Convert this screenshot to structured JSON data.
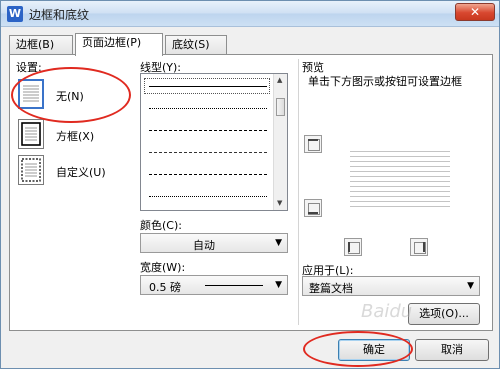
{
  "window": {
    "title": "边框和底纹",
    "app_icon": "W",
    "close_label": "✕"
  },
  "tabs": [
    {
      "label": "边框(B)"
    },
    {
      "label": "页面边框(P)",
      "active": true
    },
    {
      "label": "底纹(S)"
    }
  ],
  "settings": {
    "label": "设置:",
    "items": [
      {
        "label": "无(N)",
        "selected": true
      },
      {
        "label": "方框(X)"
      },
      {
        "label": "自定义(U)"
      }
    ]
  },
  "line_style": {
    "label": "线型(Y):"
  },
  "color": {
    "label": "颜色(C):",
    "value": "自动"
  },
  "width": {
    "label": "宽度(W):",
    "value": "0.5  磅"
  },
  "preview": {
    "label": "预览",
    "hint": "单击下方图示或按钮可设置边框"
  },
  "apply_to": {
    "label": "应用于(L):",
    "value": "整篇文档"
  },
  "options_label": "选项(O)...",
  "ok_label": "确定",
  "cancel_label": "取消",
  "watermark": "Baidu",
  "colors": {
    "highlight_ellipse": "#e02a20",
    "title_bar": "#cfe0f3"
  }
}
